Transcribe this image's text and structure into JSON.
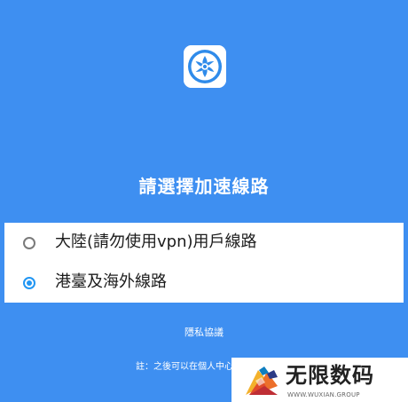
{
  "app": {
    "icon_name": "vpn-app-icon"
  },
  "title": "請選擇加速線路",
  "options": [
    {
      "label": "大陸(請勿使用vpn)用戶線路",
      "selected": false
    },
    {
      "label": "港臺及海外線路",
      "selected": true
    }
  ],
  "privacy_link": "隱私協議",
  "note": "註：之後可以在個人中心",
  "watermark": {
    "title": "无限数码",
    "subtitle": "WWW.WUXIAN.GROUP",
    "logo_name": "wuxian-logo"
  },
  "colors": {
    "background": "#3e8ff1",
    "accent": "#2196f3",
    "panel": "#ffffff"
  }
}
